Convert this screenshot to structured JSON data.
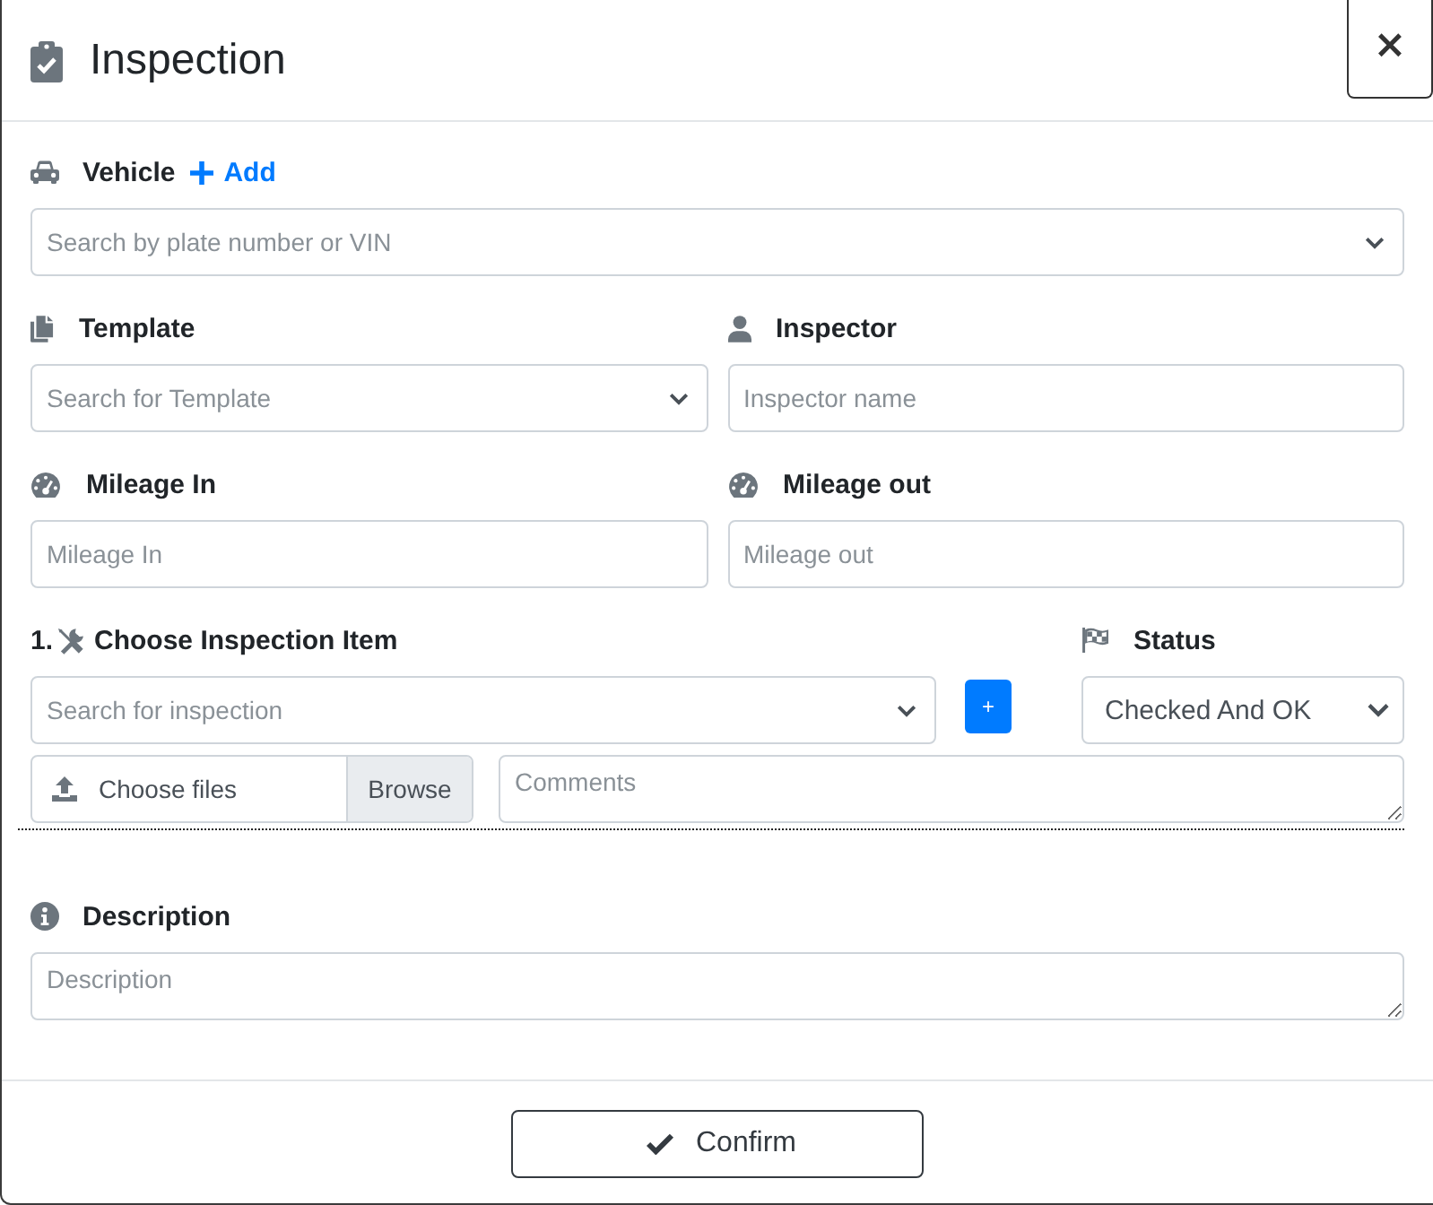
{
  "dialog": {
    "title": "Inspection",
    "close": "×"
  },
  "vehicle": {
    "label": "Vehicle",
    "add_link": "Add",
    "search": {
      "placeholder": "Search by plate number or VIN"
    }
  },
  "template": {
    "label": "Template",
    "select": {
      "placeholder": "Search for Template"
    }
  },
  "inspector": {
    "label": "Inspector",
    "input": {
      "placeholder": "Inspector name"
    }
  },
  "mileage_in": {
    "label": "Mileage In",
    "input": {
      "placeholder": "Mileage In"
    }
  },
  "mileage_out": {
    "label": "Mileage out",
    "input": {
      "placeholder": "Mileage out"
    }
  },
  "inspection_item": {
    "number": "1.",
    "label": "Choose Inspection Item",
    "select": {
      "placeholder": "Search for inspection"
    },
    "add_button": "+"
  },
  "status": {
    "label": "Status",
    "select": {
      "value": "Checked And OK"
    }
  },
  "attachment": {
    "label": "Choose files",
    "button": "Browse"
  },
  "comments": {
    "placeholder": "Comments"
  },
  "description": {
    "label": "Description",
    "textarea": {
      "placeholder": "Description"
    }
  },
  "footer": {
    "confirm": "Confirm"
  }
}
